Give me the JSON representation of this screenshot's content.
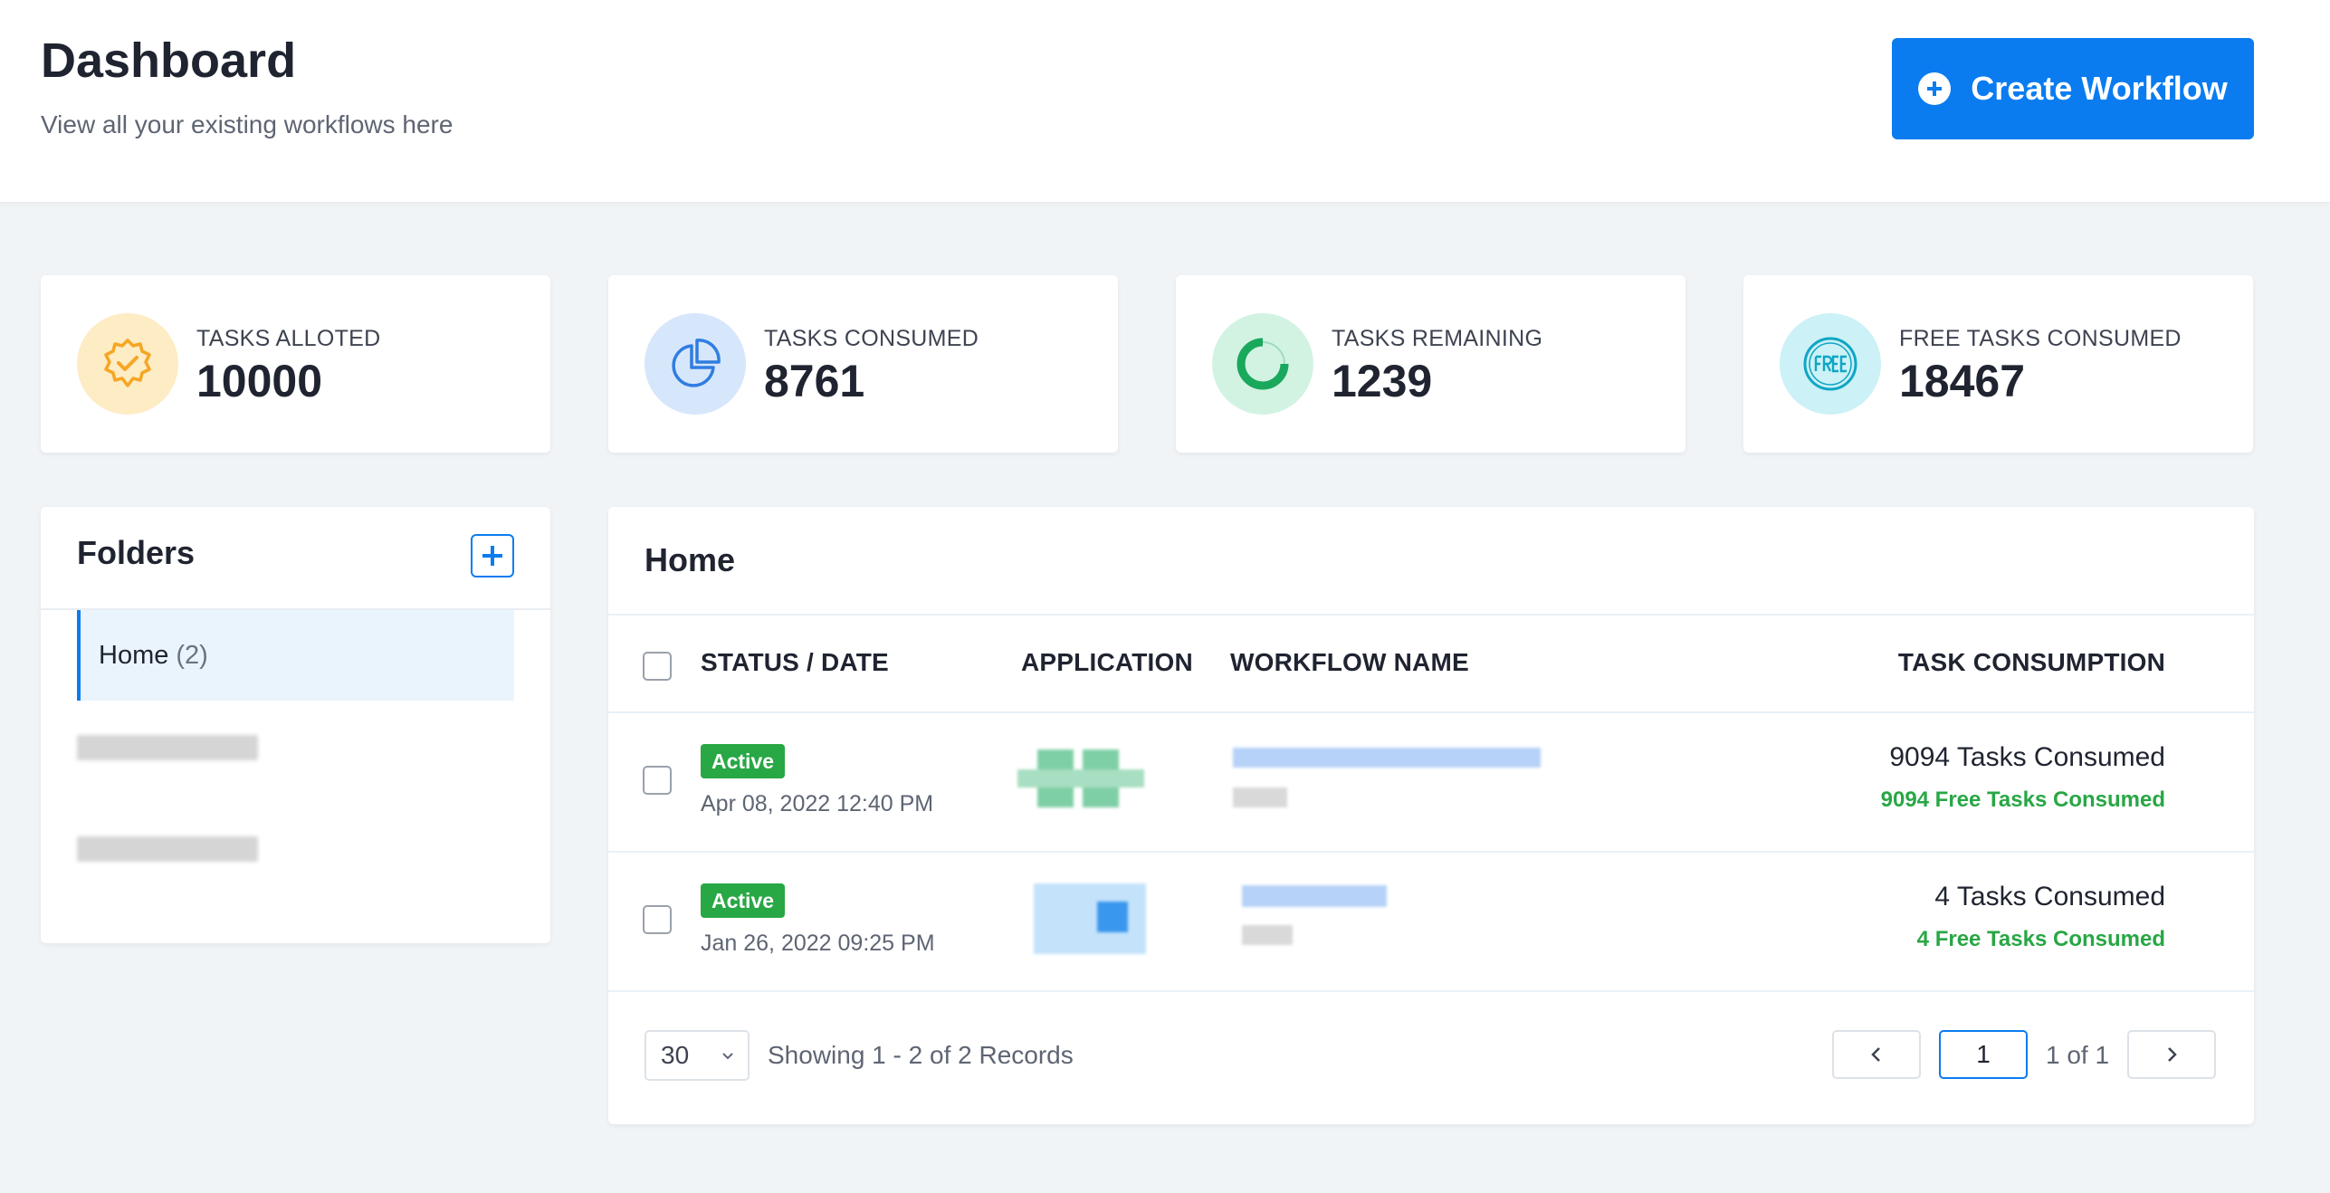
{
  "header": {
    "title": "Dashboard",
    "subtitle": "View all your existing workflows here",
    "create_button": "Create Workflow"
  },
  "stats": [
    {
      "label": "TASKS ALLOTED",
      "value": "10000",
      "icon": "badge-check-icon",
      "color": "#f5a623"
    },
    {
      "label": "TASKS CONSUMED",
      "value": "8761",
      "icon": "pie-chart-icon",
      "color": "#2f7de1"
    },
    {
      "label": "TASKS REMAINING",
      "value": "1239",
      "icon": "donut-progress-icon",
      "color": "#1aa85c"
    },
    {
      "label": "FREE TASKS CONSUMED",
      "value": "18467",
      "icon": "free-stamp-icon",
      "color": "#0fa6c4"
    }
  ],
  "folders": {
    "title": "Folders",
    "items": [
      {
        "label": "Home",
        "count": "(2)"
      }
    ]
  },
  "table": {
    "title": "Home",
    "columns": [
      "STATUS / DATE",
      "APPLICATION",
      "WORKFLOW NAME",
      "TASK CONSUMPTION"
    ],
    "rows": [
      {
        "status": "Active",
        "date": "Apr 08, 2022 12:40 PM",
        "consumed": "9094 Tasks Consumed",
        "free_consumed": "9094 Free Tasks Consumed"
      },
      {
        "status": "Active",
        "date": "Jan 26, 2022 09:25 PM",
        "consumed": "4 Tasks Consumed",
        "free_consumed": "4 Free Tasks Consumed"
      }
    ],
    "footer": {
      "page_size": "30",
      "records_text": "Showing 1 - 2 of 2 Records",
      "current_page": "1",
      "page_of": "1 of 1"
    }
  },
  "colors": {
    "accent": "#0a7cf0",
    "success": "#28a745",
    "background": "#f1f4f7"
  }
}
